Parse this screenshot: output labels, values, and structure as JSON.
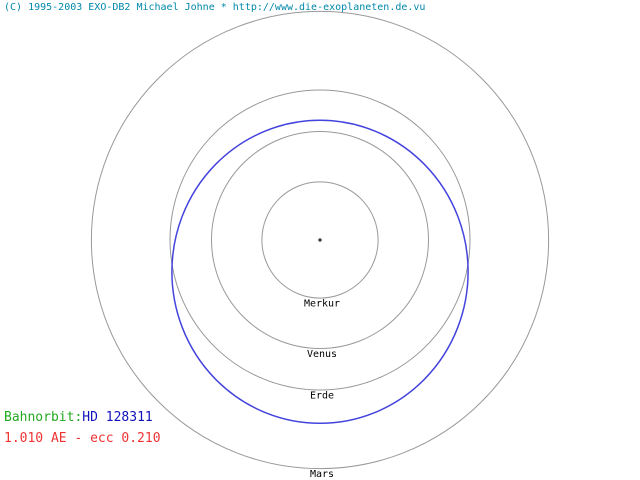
{
  "header": {
    "credit": "(C) 1995-2003 EXO-DB2 Michael Johne * http://www.die-exoplaneten.de.vu",
    "credit_color": "#0088aa"
  },
  "orbits": [
    {
      "name": "Merkur",
      "a_au": 0.387
    },
    {
      "name": "Venus",
      "a_au": 0.723
    },
    {
      "name": "Erde",
      "a_au": 1.0
    },
    {
      "name": "Mars",
      "a_au": 1.524
    }
  ],
  "planet_orbit": {
    "label_prefix": "Bahnorbit:",
    "star": "HD 128311",
    "params_text": "1.010 AE - ecc 0.210",
    "semi_major_axis_au": 1.01,
    "eccentricity": 0.21,
    "orbit_color": "#4444dd"
  },
  "colors": {
    "reference_orbit": "#999999",
    "prefix": "#22aa22",
    "star_name": "#1111bb",
    "params": "#ee3333"
  }
}
